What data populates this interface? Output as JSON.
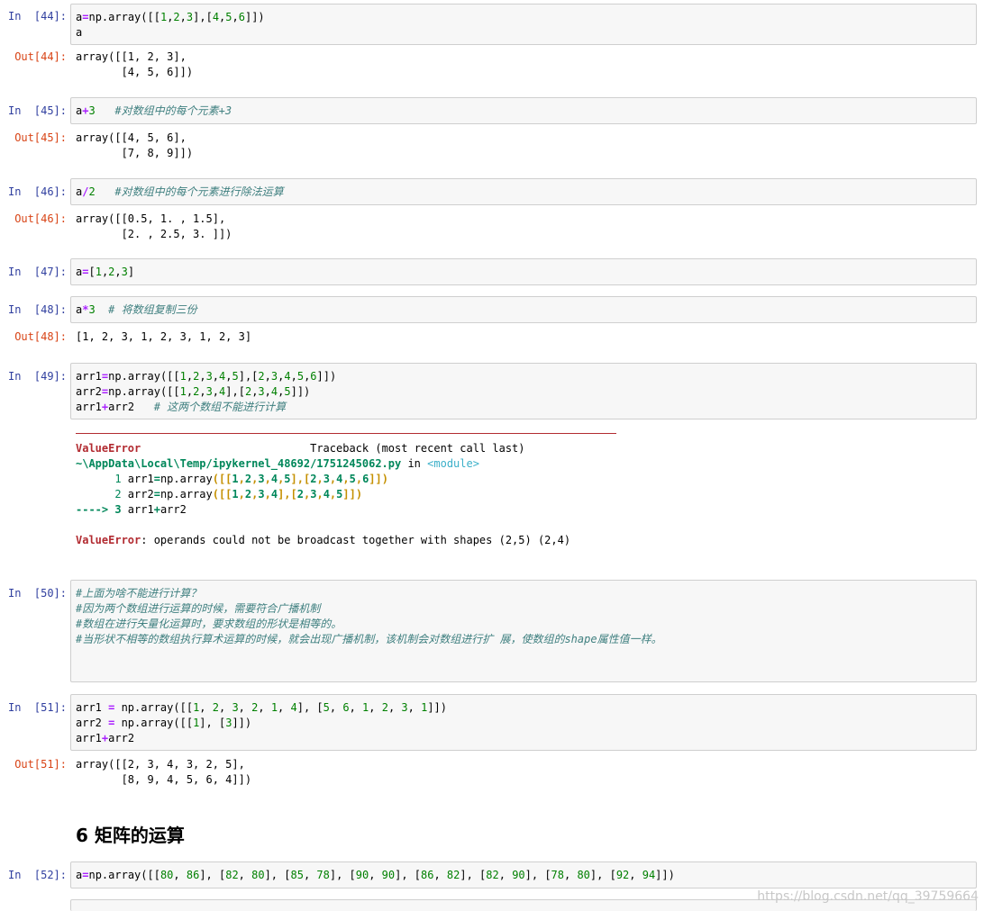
{
  "cells": [
    {
      "in_prompt": "In  [44]:",
      "out_prompt": "Out[44]:",
      "code": [
        "a=np.array([[1,2,3],[4,5,6]])",
        "a"
      ],
      "output": [
        "array([[1, 2, 3],",
        "       [4, 5, 6]])"
      ]
    },
    {
      "in_prompt": "In  [45]:",
      "out_prompt": "Out[45]:",
      "code": [
        "a+3   #对数组中的每个元素+3"
      ],
      "output": [
        "array([[4, 5, 6],",
        "       [7, 8, 9]])"
      ]
    },
    {
      "in_prompt": "In  [46]:",
      "out_prompt": "Out[46]:",
      "code": [
        "a/2   #对数组中的每个元素进行除法运算"
      ],
      "output": [
        "array([[0.5, 1. , 1.5],",
        "       [2. , 2.5, 3. ]])"
      ]
    },
    {
      "in_prompt": "In  [47]:",
      "code": [
        "a=[1,2,3]"
      ]
    },
    {
      "in_prompt": "In  [48]:",
      "out_prompt": "Out[48]:",
      "code": [
        "a*3  # 将数组复制三份"
      ],
      "output": [
        "[1, 2, 3, 1, 2, 3, 1, 2, 3]"
      ]
    },
    {
      "in_prompt": "In  [49]:",
      "code": [
        "arr1=np.array([[1,2,3,4,5],[2,3,4,5,6]])",
        "arr2=np.array([[1,2,3,4],[2,3,4,5]])",
        "arr1+arr2   # 这两个数组不能进行计算"
      ],
      "traceback": {
        "error_name": "ValueError",
        "header_right": "Traceback (most recent call last)",
        "path": "~\\AppData\\Local\\Temp/ipykernel_48692/1751245062.py",
        "in_word": " in ",
        "module": "<module>",
        "lines": [
          {
            "marker": "      1 ",
            "code": "arr1=np.array([[1,2,3,4,5],[2,3,4,5,6]])"
          },
          {
            "marker": "      2 ",
            "code": "arr2=np.array([[1,2,3,4],[2,3,4,5]])"
          },
          {
            "marker": "----> 3 ",
            "code": "arr1+arr2"
          }
        ],
        "message": ": operands could not be broadcast together with shapes (2,5) (2,4)"
      }
    },
    {
      "in_prompt": "In  [50]:",
      "code": [
        "#上面为啥不能进行计算？",
        "#因为两个数组进行运算的时候，需要符合广播机制",
        "#数组在进行矢量化运算时，要求数组的形状是相等的。",
        "#当形状不相等的数组执行算术运算的时候，就会出现广播机制，该机制会对数组进行扩 展，使数组的shape属性值一样。"
      ]
    },
    {
      "in_prompt": "In  [51]:",
      "out_prompt": "Out[51]:",
      "code": [
        "arr1 = np.array([[1, 2, 3, 2, 1, 4], [5, 6, 1, 2, 3, 1]])",
        "arr2 = np.array([[1], [3]])",
        "arr1+arr2"
      ],
      "output": [
        "array([[2, 3, 4, 3, 2, 5],",
        "       [8, 9, 4, 5, 6, 4]])"
      ]
    },
    {
      "in_prompt": "In  [52]:",
      "code": [
        "a=np.array([[80, 86], [82, 80], [85, 78], [90, 90], [86, 82], [82, 90], [78, 80], [92, 94]])"
      ]
    }
  ],
  "markdown_heading": "6  矩阵的运算",
  "watermark": "https://blog.csdn.net/qq_39759664"
}
